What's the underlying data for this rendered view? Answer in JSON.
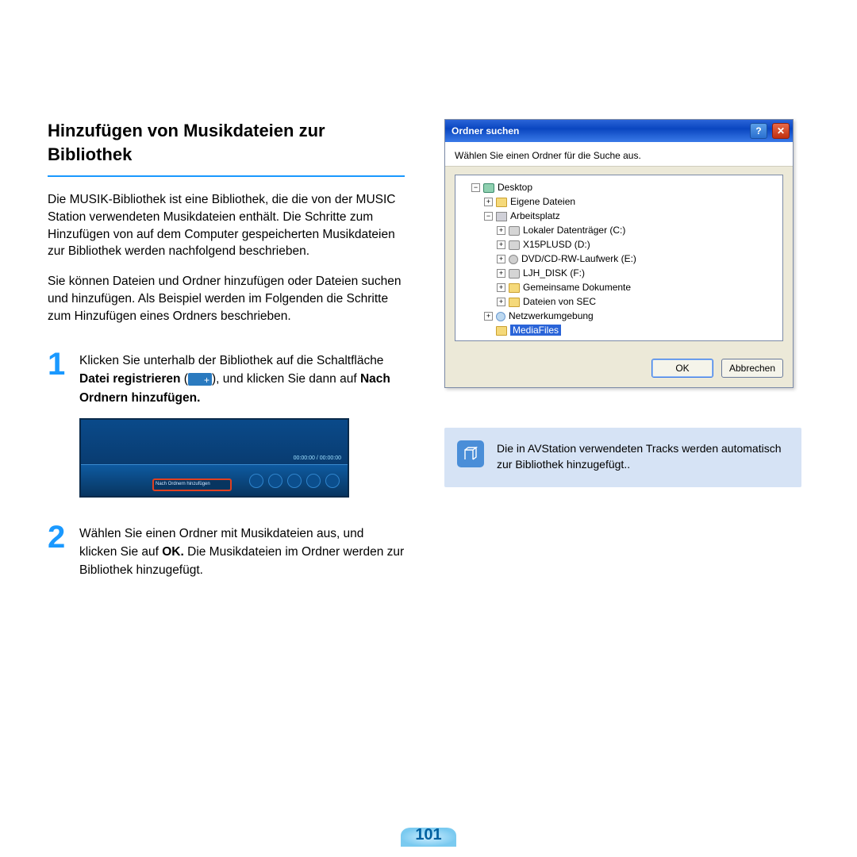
{
  "heading": "Hinzufügen von Musikdateien zur Bibliothek",
  "para1": "Die MUSIK-Bibliothek ist eine Bibliothek, die die von der MUSIC Station verwendeten Musikdateien enthält. Die Schritte zum Hinzufügen von auf dem Computer gespeicherten Musikdateien zur Bibliothek werden nachfolgend beschrieben.",
  "para2": "Sie können Dateien und Ordner hinzufügen oder Dateien suchen und hinzufügen. Als Beispiel werden im Folgenden die Schritte zum Hinzufügen eines Ordners beschrieben.",
  "steps": [
    {
      "num": "1",
      "pre": "Klicken Sie unterhalb der Bibliothek auf die Schaltfläche ",
      "bold1": "Datei registrieren",
      "mid": " (",
      "post1": "), und klicken Sie dann auf ",
      "bold2": "Nach Ordnern hinzufügen.",
      "player_highlight_label": "Nach Ordnern hinzufügen",
      "player_timecode": "00:00:00 / 00:00:00"
    },
    {
      "num": "2",
      "pre": "Wählen Sie einen Ordner mit Musikdateien aus, und klicken Sie auf ",
      "bold1": "OK.",
      "post": " Die Musikdateien im Ordner werden zur Bibliothek hinzugefügt."
    }
  ],
  "dialog": {
    "title": "Ordner suchen",
    "instruction": "Wählen Sie einen Ordner für die Suche aus.",
    "ok": "OK",
    "cancel": "Abbrechen",
    "tree": {
      "desktop": "Desktop",
      "eigene": "Eigene Dateien",
      "arbeitsplatz": "Arbeitsplatz",
      "c": "Lokaler Datenträger (C:)",
      "d": "X15PLUSD (D:)",
      "e": "DVD/CD-RW-Laufwerk (E:)",
      "f": "LJH_DISK (F:)",
      "gemeinsame": "Gemeinsame Dokumente",
      "sec": "Dateien von SEC",
      "netz": "Netzwerkumgebung",
      "mediafiles": "MediaFiles"
    }
  },
  "note": "Die in AVStation verwendeten Tracks werden automatisch zur Bibliothek hinzugefügt..",
  "page_number": "101"
}
